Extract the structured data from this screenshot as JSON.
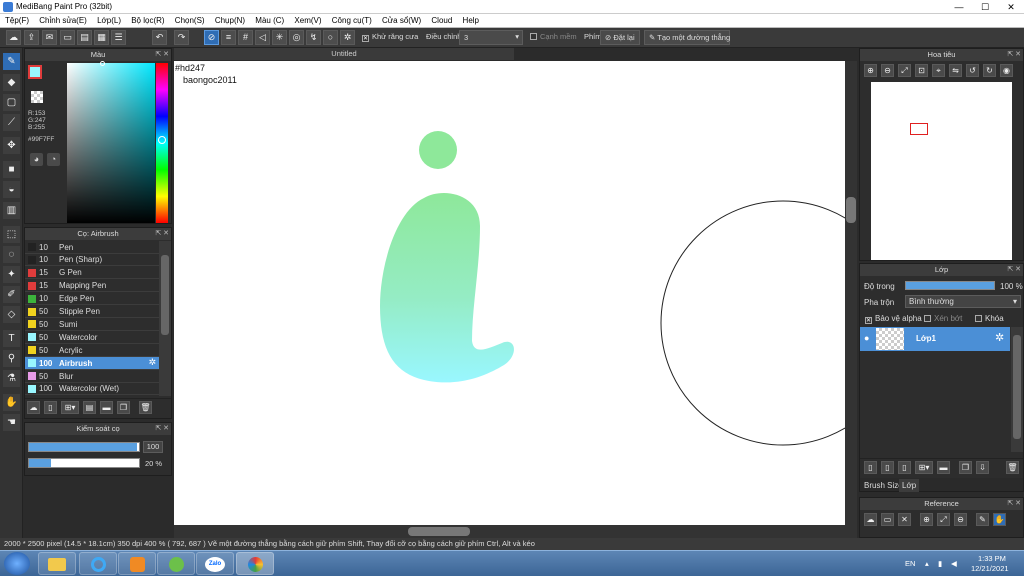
{
  "window": {
    "title": "MediBang Paint Pro (32bit)",
    "minimize": "—",
    "maximize": "☐",
    "close": "✕"
  },
  "menu": [
    "Tệp(F)",
    "Chỉnh sửa(E)",
    "Lớp(L)",
    "Bộ lọc(R)",
    "Chọn(S)",
    "Chụp(N)",
    "Màu (C)",
    "Xem(V)",
    "Công cụ(T)",
    "Cửa sổ(W)",
    "Cloud",
    "Help"
  ],
  "toolbar": {
    "antialias_label": "Khử răng cưa",
    "correction_label": "Điều chỉnh",
    "correction_value": "3",
    "edge_label": "Cạnh mềm",
    "key_label": "Phím",
    "reset_label": "Đặt lại",
    "line_label": "Tạo một đường thẳng"
  },
  "color_panel": {
    "title": "Màu",
    "r": "R:153",
    "g": "G:247",
    "b": "B:255",
    "hex": "#99F7FF"
  },
  "brush_panel": {
    "title": "Cọ: Airbrush",
    "brushes": [
      {
        "size": "10",
        "name": "Pen",
        "color": "#222222"
      },
      {
        "size": "10",
        "name": "Pen (Sharp)",
        "color": "#222222"
      },
      {
        "size": "15",
        "name": "G Pen",
        "color": "#e03c3c"
      },
      {
        "size": "15",
        "name": "Mapping Pen",
        "color": "#e03c3c"
      },
      {
        "size": "10",
        "name": "Edge Pen",
        "color": "#3cb43c"
      },
      {
        "size": "50",
        "name": "Stipple Pen",
        "color": "#f0d21e"
      },
      {
        "size": "50",
        "name": "Sumi",
        "color": "#f0d21e"
      },
      {
        "size": "50",
        "name": "Watercolor",
        "color": "#99f7ff"
      },
      {
        "size": "50",
        "name": "Acrylic",
        "color": "#f0d21e"
      },
      {
        "size": "100",
        "name": "Airbrush",
        "color": "#99f7ff"
      },
      {
        "size": "50",
        "name": "Blur",
        "color": "#e79be7"
      },
      {
        "size": "100",
        "name": "Watercolor (Wet)",
        "color": "#99f7ff"
      }
    ],
    "selected_index": 9
  },
  "brush_control": {
    "title": "Kiểm soát cọ",
    "size_value": "100",
    "opacity_value": "20 %",
    "size_fraction": 0.98,
    "opacity_fraction": 0.2
  },
  "document": {
    "tab": "Untitled",
    "line1": "#hd247",
    "line2": "baongoc2011"
  },
  "navigator": {
    "title": "Hoa tiêu"
  },
  "layer_panel": {
    "title": "Lớp",
    "opacity_label": "Độ trong",
    "opacity_value": "100 %",
    "opacity_fraction": 1.0,
    "blend_label": "Pha trộn",
    "blend_value": "Bình thường",
    "protect_alpha": "Bảo vệ alpha",
    "clipping": "Xén bớt",
    "lock": "Khóa",
    "layer_name": "Lớp1",
    "tab_brush_size": "Brush Size",
    "tab_layer": "Lớp"
  },
  "reference_panel": {
    "title": "Reference"
  },
  "status": {
    "text": "2000 * 2500 pixel  (14.5 * 18.1cm)  350 dpi  400 %  ( 792, 687 )  Vẽ một đường thẳng bằng cách giữ phím Shift, Thay đổi cỡ cọ bằng cách giữ phím Ctrl, Alt và kéo"
  },
  "taskbar": {
    "lang": "EN",
    "time": "1:33 PM",
    "date": "12/21/2021",
    "zalo": "Zalo"
  },
  "colors": {
    "accent": "#2f6db5",
    "selected_row": "#4b8fd6",
    "foreground": "#99f7ff",
    "green": "#8ee89a"
  }
}
